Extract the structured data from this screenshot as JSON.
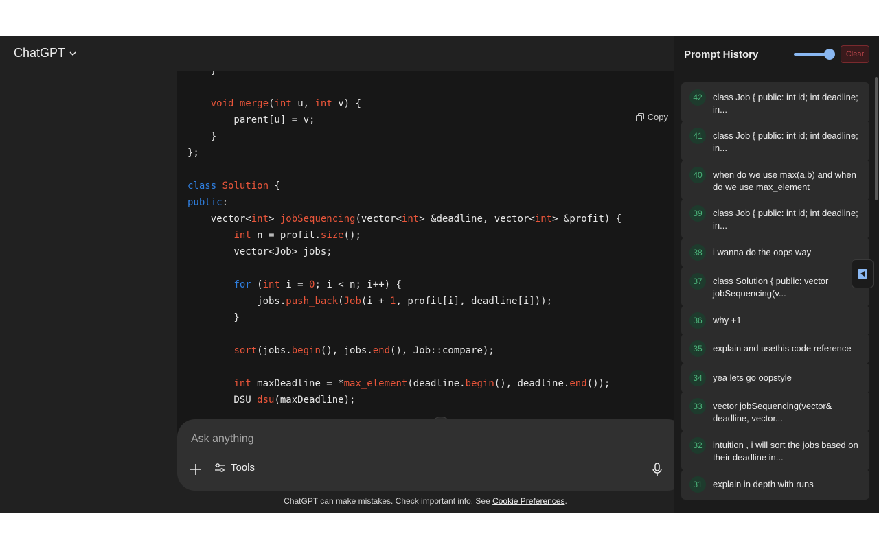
{
  "header": {
    "model_label": "ChatGPT"
  },
  "code_block": {
    "copy_label": "Copy",
    "lines": [
      [
        {
          "t": "    }"
        }
      ],
      [
        {
          "t": ""
        }
      ],
      [
        {
          "t": "    "
        },
        {
          "t": "void",
          "c": "ty"
        },
        {
          "t": " "
        },
        {
          "t": "merge",
          "c": "fn"
        },
        {
          "t": "("
        },
        {
          "t": "int",
          "c": "ty"
        },
        {
          "t": " u, "
        },
        {
          "t": "int",
          "c": "ty"
        },
        {
          "t": " v) {"
        }
      ],
      [
        {
          "t": "        parent[u] = v;"
        }
      ],
      [
        {
          "t": "    }"
        }
      ],
      [
        {
          "t": "};"
        }
      ],
      [
        {
          "t": ""
        }
      ],
      [
        {
          "t": "class",
          "c": "kw"
        },
        {
          "t": " "
        },
        {
          "t": "Solution",
          "c": "fn"
        },
        {
          "t": " {"
        }
      ],
      [
        {
          "t": "public",
          "c": "kw"
        },
        {
          "t": ":"
        }
      ],
      [
        {
          "t": "    vector<"
        },
        {
          "t": "int",
          "c": "ty"
        },
        {
          "t": "> "
        },
        {
          "t": "jobSequencing",
          "c": "fn"
        },
        {
          "t": "(vector<"
        },
        {
          "t": "int",
          "c": "ty"
        },
        {
          "t": "> &deadline, vector<"
        },
        {
          "t": "int",
          "c": "ty"
        },
        {
          "t": "> &profit) {"
        }
      ],
      [
        {
          "t": "        "
        },
        {
          "t": "int",
          "c": "ty"
        },
        {
          "t": " n = profit."
        },
        {
          "t": "size",
          "c": "fn"
        },
        {
          "t": "();"
        }
      ],
      [
        {
          "t": "        vector<Job> jobs;"
        }
      ],
      [
        {
          "t": ""
        }
      ],
      [
        {
          "t": "        "
        },
        {
          "t": "for",
          "c": "kw"
        },
        {
          "t": " ("
        },
        {
          "t": "int",
          "c": "ty"
        },
        {
          "t": " i = "
        },
        {
          "t": "0",
          "c": "num"
        },
        {
          "t": "; i < n; i++) {"
        }
      ],
      [
        {
          "t": "            jobs."
        },
        {
          "t": "push_back",
          "c": "fn"
        },
        {
          "t": "("
        },
        {
          "t": "Job",
          "c": "fn"
        },
        {
          "t": "(i + "
        },
        {
          "t": "1",
          "c": "num"
        },
        {
          "t": ", profit[i], deadline[i]));"
        }
      ],
      [
        {
          "t": "        }"
        }
      ],
      [
        {
          "t": ""
        }
      ],
      [
        {
          "t": "        "
        },
        {
          "t": "sort",
          "c": "fn"
        },
        {
          "t": "(jobs."
        },
        {
          "t": "begin",
          "c": "fn"
        },
        {
          "t": "(), jobs."
        },
        {
          "t": "end",
          "c": "fn"
        },
        {
          "t": "(), Job::compare);"
        }
      ],
      [
        {
          "t": ""
        }
      ],
      [
        {
          "t": "        "
        },
        {
          "t": "int",
          "c": "ty"
        },
        {
          "t": " maxDeadline = *"
        },
        {
          "t": "max_element",
          "c": "fn"
        },
        {
          "t": "(deadline."
        },
        {
          "t": "begin",
          "c": "fn"
        },
        {
          "t": "(), deadline."
        },
        {
          "t": "end",
          "c": "fn"
        },
        {
          "t": "());"
        }
      ],
      [
        {
          "t": "        DSU "
        },
        {
          "t": "dsu",
          "c": "fn"
        },
        {
          "t": "(maxDeadline);"
        }
      ]
    ]
  },
  "composer": {
    "placeholder": "Ask anything",
    "tools_label": "Tools"
  },
  "disclaimer": {
    "text": "ChatGPT can make mistakes. Check important info. See ",
    "link": "Cookie Preferences",
    "suffix": "."
  },
  "history_panel": {
    "title": "Prompt History",
    "clear_label": "Clear",
    "toggle_on": true,
    "items": [
      {
        "num": "42",
        "text": "class Job { public: int id; int deadline; in..."
      },
      {
        "num": "41",
        "text": "class Job { public: int id; int deadline; in..."
      },
      {
        "num": "40",
        "text": "when do we use max(a,b) and when do we use max_element"
      },
      {
        "num": "39",
        "text": "class Job { public: int id; int deadline; in..."
      },
      {
        "num": "38",
        "text": "i wanna do the oops way"
      },
      {
        "num": "37",
        "text": "class Solution { public: vector jobSequencing(v..."
      },
      {
        "num": "36",
        "text": "why +1"
      },
      {
        "num": "35",
        "text": "explain and usethis code reference"
      },
      {
        "num": "34",
        "text": "yea lets go oopstyle"
      },
      {
        "num": "33",
        "text": "vector jobSequencing(vector& deadline, vector..."
      },
      {
        "num": "32",
        "text": "intuition , i will sort the jobs based on their deadline in..."
      },
      {
        "num": "31",
        "text": "explain in depth with runs"
      }
    ]
  },
  "colors": {
    "background": "#212121",
    "code_background": "#171717",
    "keyword": "#2f7fe0",
    "type": "#e9553a",
    "badge_green": "#4bb37a",
    "accent_blue": "#8ab8f2",
    "clear_red": "#c0474d"
  },
  "icons": {
    "model_dropdown": "chevron-down-icon",
    "copy": "copy-icon",
    "scroll_down": "arrow-down-icon",
    "plus": "plus-icon",
    "tools": "sliders-icon",
    "mic": "microphone-icon",
    "collapse": "triangle-left-icon"
  }
}
